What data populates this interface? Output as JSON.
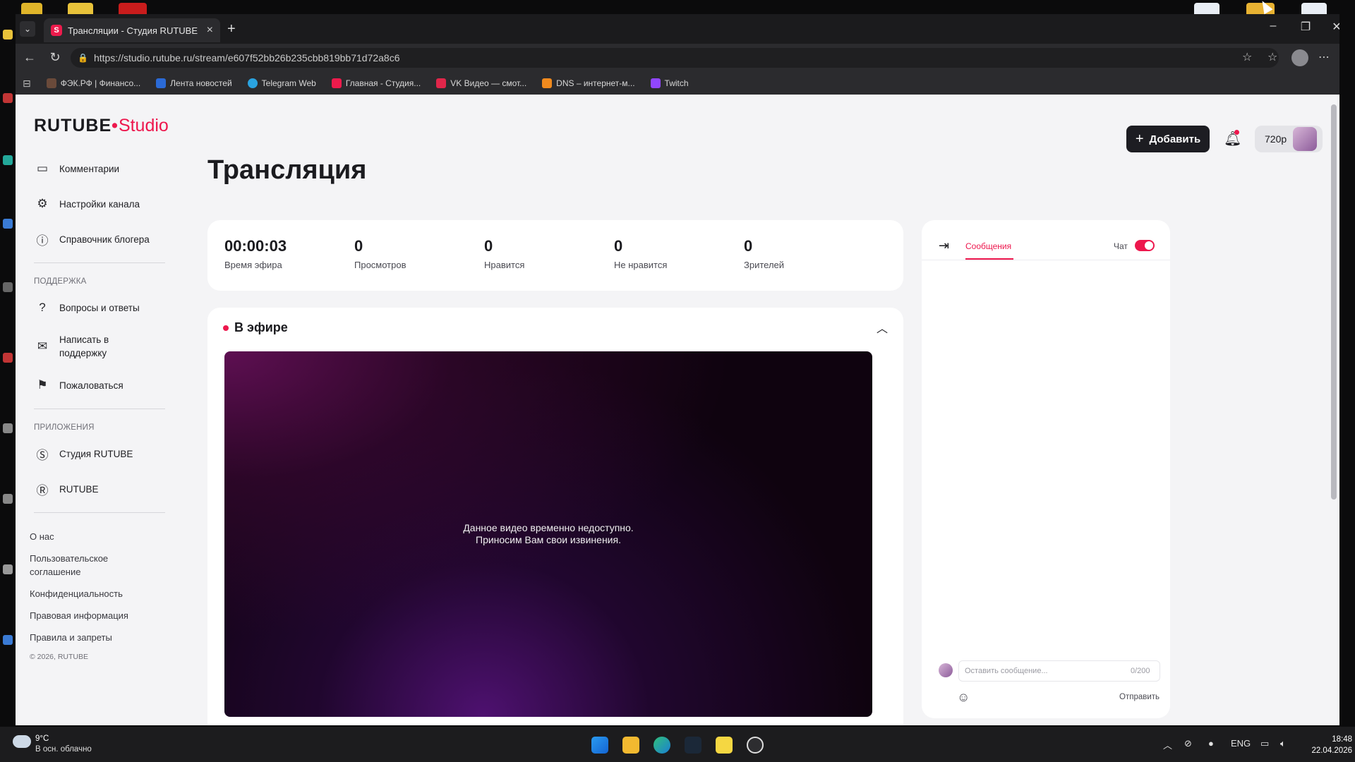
{
  "browser": {
    "tab_title": "Трансляции - Студия RUTUBE",
    "url": "https://studio.rutube.ru/stream/e607f52bb26b235cbb819bb71d72a8c6",
    "bookmarks": [
      {
        "label": "ФЭК.РФ | Финансо...",
        "color": "#6a4a3a"
      },
      {
        "label": "Лента новостей",
        "color": "#2b6ad6"
      },
      {
        "label": "Telegram Web",
        "color": "#2aa3e0"
      },
      {
        "label": "Главная - Студия...",
        "color": "#ec1b4c"
      },
      {
        "label": "VK Видео — смот...",
        "color": "#e0264a"
      },
      {
        "label": "DNS – интернет-м...",
        "color": "#f08a1e"
      },
      {
        "label": "Twitch",
        "color": "#9146ff"
      }
    ]
  },
  "header": {
    "logo_main": "RUTUBE",
    "logo_accent": "Studio",
    "add_button": "Добавить",
    "quality": "720p"
  },
  "sidebar": {
    "items": [
      {
        "label": "Комментарии",
        "icon": "comment-icon"
      },
      {
        "label": "Настройки канала",
        "icon": "gear-icon"
      },
      {
        "label": "Справочник блогера",
        "icon": "info-icon"
      }
    ],
    "support_title": "ПОДДЕРЖКА",
    "support_items": [
      {
        "label": "Вопросы и ответы",
        "icon": "question-icon"
      },
      {
        "label": "Написать в поддержку",
        "icon": "mail-icon"
      },
      {
        "label": "Пожаловаться",
        "icon": "flag-icon"
      }
    ],
    "apps_title": "ПРИЛОЖЕНИЯ",
    "app_items": [
      {
        "label": "Студия RUTUBE",
        "icon": "studio-app-icon"
      },
      {
        "label": "RUTUBE",
        "icon": "rutube-app-icon"
      }
    ],
    "footer_links": [
      "О нас",
      "Пользовательское соглашение",
      "Конфиденциальность",
      "Правовая информация",
      "Правила и запреты"
    ],
    "copyright": "© 2026, RUTUBE"
  },
  "main": {
    "title": "Трансляция",
    "stats": [
      {
        "value": "00:00:03",
        "label": "Время эфира"
      },
      {
        "value": "0",
        "label": "Просмотров"
      },
      {
        "value": "0",
        "label": "Нравится"
      },
      {
        "value": "0",
        "label": "Не нравится"
      },
      {
        "value": "0",
        "label": "Зрителей"
      }
    ],
    "live_title": "В эфире",
    "video_message_line1": "Данное видео временно недоступно.",
    "video_message_line2": "Приносим Вам свои извинения."
  },
  "chat": {
    "tab_messages": "Сообщения",
    "toggle_label": "Чат",
    "toggle_on": true,
    "input_placeholder": "Оставить сообщение...",
    "counter": "0/200",
    "send_label": "Отправить"
  },
  "taskbar": {
    "temperature": "9°C",
    "weather": "В осн. облачно",
    "language": "ENG",
    "time": "18:48",
    "date": "22.04.2026"
  },
  "colors": {
    "accent": "#ed174d",
    "dark": "#1d1d22",
    "page_bg": "#f4f4f6"
  }
}
